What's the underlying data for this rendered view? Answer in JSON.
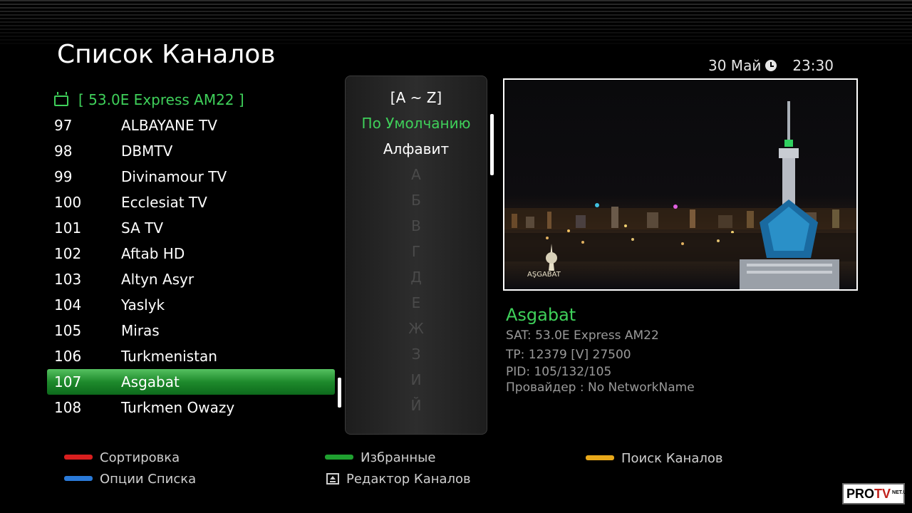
{
  "header": {
    "title": "Список Каналов",
    "date": "30 Май",
    "time": "23:30"
  },
  "satellite": {
    "label": "[ 53.0E Express AM22 ]"
  },
  "channels": [
    {
      "num": "97",
      "name": "ALBAYANE TV"
    },
    {
      "num": "98",
      "name": "DBMTV"
    },
    {
      "num": "99",
      "name": "Divinamour TV"
    },
    {
      "num": "100",
      "name": "Ecclesiat TV"
    },
    {
      "num": "101",
      "name": "SA TV"
    },
    {
      "num": "102",
      "name": "Aftab HD"
    },
    {
      "num": "103",
      "name": "Altyn Asyr"
    },
    {
      "num": "104",
      "name": "Yaslyk"
    },
    {
      "num": "105",
      "name": "Miras"
    },
    {
      "num": "106",
      "name": "Turkmenistan"
    },
    {
      "num": "107",
      "name": "Asgabat",
      "selected": true
    },
    {
      "num": "108",
      "name": "Turkmen Owazy"
    }
  ],
  "sort_panel": {
    "header": "[A ~ Z]",
    "options": [
      "По Умолчанию",
      "Алфавит"
    ],
    "active_option": "По Умолчанию",
    "letters": [
      "А",
      "Б",
      "В",
      "Г",
      "Д",
      "Е",
      "Ж",
      "З",
      "И",
      "Й"
    ]
  },
  "preview": {
    "caption": "AŞGABAT"
  },
  "info": {
    "name": "Asgabat",
    "sat": "SAT: 53.0E Express AM22",
    "tp": "TP: 12379 [V] 27500",
    "pid": "PID: 105/132/105",
    "provider": "Провайдер : No NetworkName"
  },
  "legend": {
    "sort": "Сортировка",
    "list_options": "Опции Списка",
    "favorites": "Избранные",
    "channel_editor": "Редактор Каналов",
    "channel_search": "Поиск Каналов"
  },
  "logo": {
    "pro": "PRO",
    "tv": "TV",
    "suffix": "NET.UA"
  },
  "colors": {
    "accent_green": "#3fd05a",
    "red_key": "#d81e1e",
    "green_key": "#1fa030",
    "yellow_key": "#e8a81a",
    "blue_key": "#2a7ad8"
  }
}
